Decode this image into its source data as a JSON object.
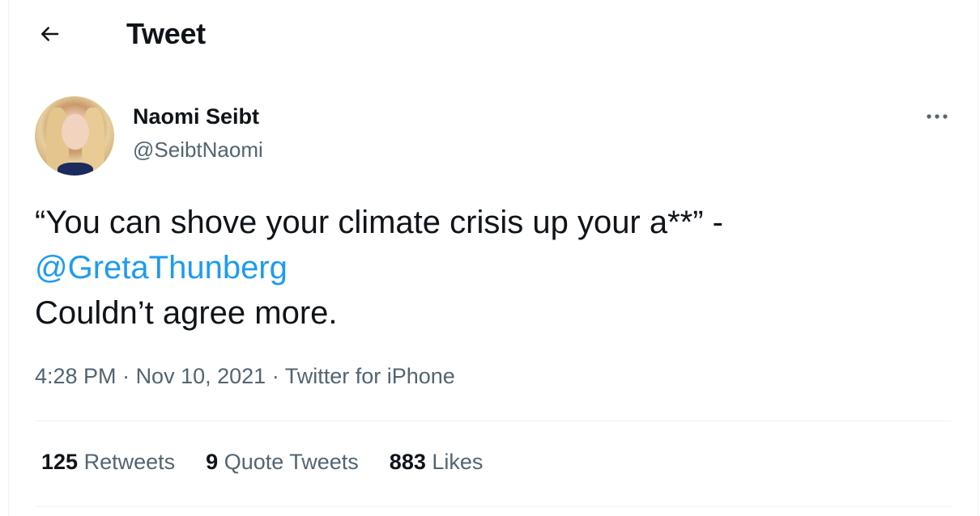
{
  "header": {
    "title": "Tweet",
    "back_icon": "arrow-left-icon"
  },
  "tweet": {
    "author": {
      "name": "Naomi Seibt",
      "handle": "@SeibtNaomi"
    },
    "more_icon": "more-dots-icon",
    "text": {
      "line1": "“You can shove your climate crisis up your a**” -",
      "mention": "@GretaThunberg",
      "line3": "Couldn’t agree more."
    },
    "meta": {
      "time": "4:28 PM",
      "separator": " · ",
      "date": "Nov 10, 2021",
      "source": "Twitter for iPhone"
    },
    "stats": {
      "retweets": {
        "count": "125",
        "label": "Retweets"
      },
      "quote_tweets": {
        "count": "9",
        "label": "Quote Tweets"
      },
      "likes": {
        "count": "883",
        "label": "Likes"
      }
    }
  },
  "colors": {
    "text": "#0f1419",
    "secondary": "#536471",
    "accent": "#1d9bf0",
    "divider": "#eff3f4"
  }
}
